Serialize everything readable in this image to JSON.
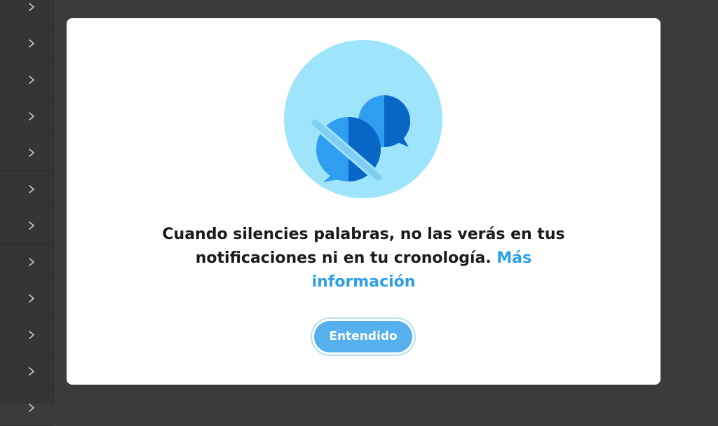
{
  "colors": {
    "backdrop": "#3a3b3d",
    "modal_bg": "#ffffff",
    "accent": "#2c9fe6",
    "button_bg": "#56b0ee",
    "illustration_circle": "#9ee4fb",
    "bubble_light": "#2f9ef0",
    "bubble_dark": "#0866c7"
  },
  "sidebar": {
    "rows": [
      {
        "icon": "chevron-right-icon"
      },
      {
        "icon": "chevron-right-icon"
      },
      {
        "icon": "chevron-right-icon"
      },
      {
        "icon": "chevron-right-icon"
      },
      {
        "icon": "chevron-right-icon"
      },
      {
        "icon": "chevron-right-icon"
      },
      {
        "icon": "chevron-right-icon"
      },
      {
        "icon": "chevron-right-icon"
      },
      {
        "icon": "chevron-right-icon"
      },
      {
        "icon": "chevron-right-icon"
      },
      {
        "icon": "chevron-right-icon"
      },
      {
        "icon": "chevron-right-icon"
      }
    ]
  },
  "dialog": {
    "illustration_icon": "muted-chat-bubbles-icon",
    "message_text": "Cuando silencies palabras, no las verás en tus notificaciones ni en tu cronología.",
    "learn_more_link": "Más información",
    "confirm_button": "Entendido"
  }
}
